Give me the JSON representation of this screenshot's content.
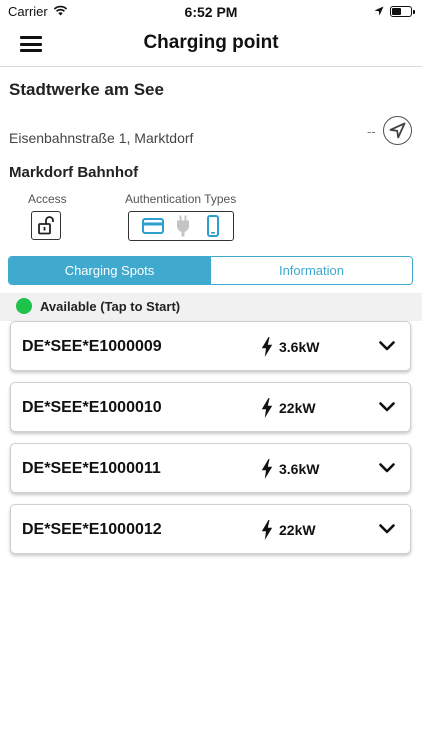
{
  "status_bar": {
    "carrier": "Carrier",
    "time": "6:52 PM"
  },
  "nav": {
    "title": "Charging point"
  },
  "operator": "Stadtwerke am See",
  "address": "Eisenbahnstraße 1, Marktdorf",
  "distance": "--",
  "station_name": "Markdorf Bahnhof",
  "access_label": "Access",
  "auth_types_label": "Authentication Types",
  "auth_types": [
    "card-icon",
    "plug-icon",
    "phone-icon"
  ],
  "tabs": [
    {
      "label": "Charging Spots",
      "active": true
    },
    {
      "label": "Information",
      "active": false
    }
  ],
  "availability": {
    "text": "Available  (Tap to Start)",
    "color": "#1fc24a"
  },
  "spots": [
    {
      "id": "DE*SEE*E1000009",
      "power": "3.6kW"
    },
    {
      "id": "DE*SEE*E1000010",
      "power": "22kW"
    },
    {
      "id": "DE*SEE*E1000011",
      "power": "3.6kW"
    },
    {
      "id": "DE*SEE*E1000012",
      "power": "22kW"
    }
  ],
  "colors": {
    "accent": "#3fa9ce",
    "available": "#1fc24a"
  }
}
